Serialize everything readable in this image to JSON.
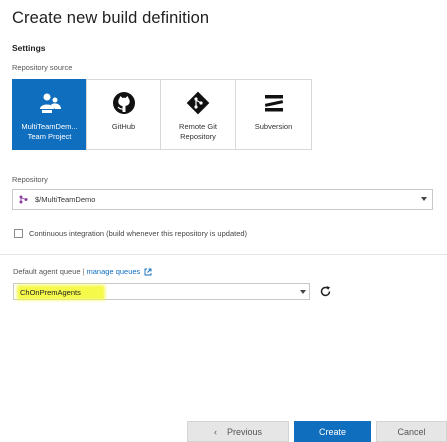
{
  "dialog": {
    "title": "Create new build definition"
  },
  "settings": {
    "heading": "Settings",
    "repo_source_label": "Repository source",
    "sources": [
      {
        "label": "MultiTeamDem...\nTeam Project",
        "icon": "team-project-icon",
        "selected": true
      },
      {
        "label": "GitHub",
        "icon": "github-icon",
        "selected": false
      },
      {
        "label": "Remote Git\nRepository",
        "icon": "git-icon",
        "selected": false
      },
      {
        "label": "Subversion",
        "icon": "subversion-icon",
        "selected": false
      }
    ],
    "repository_label": "Repository",
    "repository_value": "$/MultiTeamDemo",
    "ci_label": "Continuous integration (build whenever this repository is updated)",
    "ci_checked": false
  },
  "queue": {
    "label": "Default agent queue",
    "separator": "|",
    "manage_link": "manage queues",
    "value": "ChOnPremAgents"
  },
  "buttons": {
    "previous": "Previous",
    "previous_glyph": "‹",
    "create": "Create",
    "cancel": "Cancel"
  },
  "colors": {
    "accent": "#106ebe",
    "highlight": "#f5f94a"
  }
}
